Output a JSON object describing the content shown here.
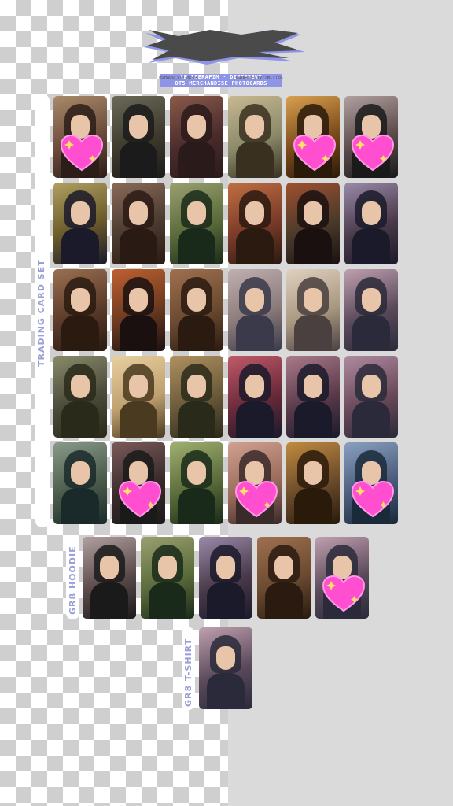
{
  "header": {
    "line1": "LE SSERAFIM · DIFFERENT",
    "line2": "OT5 MERCHANDISE PHOTOCARDS",
    "handle_insta": "@SHADO_VV/INSTA",
    "handle_twitter": "@SHADO_VVV/TWITTER"
  },
  "sections": {
    "trading": "TRADING CARD SET",
    "hoodie": "GR8 HOODIE",
    "tshirt": "GR8 T-SHIRT"
  },
  "colors": {
    "accent": "#8f95e6",
    "heart": "#ff4fd0"
  }
}
